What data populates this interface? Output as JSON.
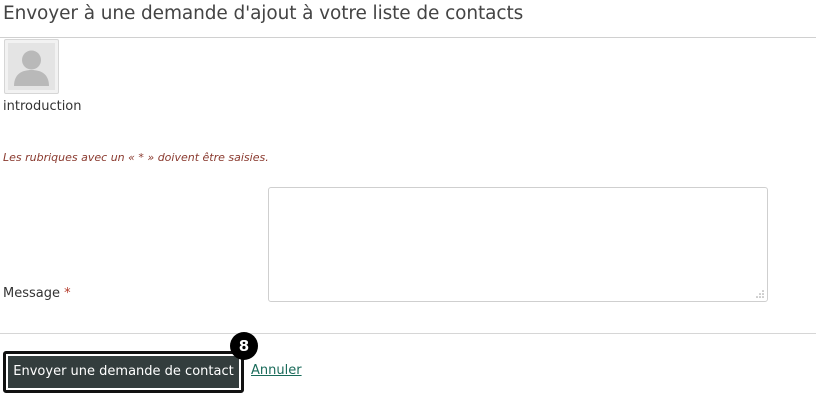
{
  "page": {
    "title": "Envoyer à une demande d'ajout à votre liste de contacts"
  },
  "recipient": {
    "avatar_icon": "user-silhouette-icon",
    "username": "introduction"
  },
  "form": {
    "required_note": "Les rubriques avec un « * » doivent être saisies.",
    "message_label": "Message",
    "required_marker": "*",
    "message_value": ""
  },
  "actions": {
    "submit_label": "Envoyer une demande de contact",
    "cancel_label": "Annuler",
    "step_badge": "8"
  },
  "colors": {
    "button_bg": "#333d3d",
    "link": "#1a6b5a",
    "required_note": "#8a3a2f"
  }
}
